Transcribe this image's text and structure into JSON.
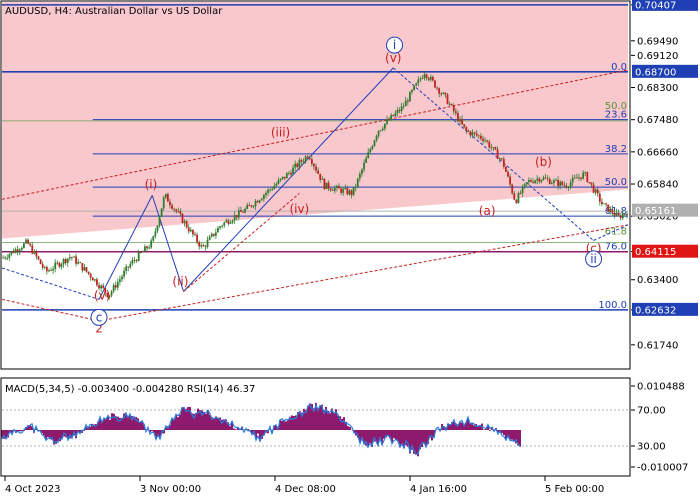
{
  "chart_data": {
    "type": "candlestick",
    "title": "AUDUSD, H4:  Australian Dollar vs US Dollar",
    "price_axis": {
      "ylim": [
        0.6115,
        0.7048
      ],
      "ticks": [
        "0.70407",
        "0.69490",
        "0.69120",
        "0.68300",
        "0.67480",
        "0.66660",
        "0.65840",
        "0.65020",
        "0.64115",
        "0.63400",
        "0.62632",
        "0.61740"
      ]
    },
    "price_tags": [
      {
        "label": "0.70407",
        "value": 0.70407,
        "color": "#1f3fb5"
      },
      {
        "label": "0.68700",
        "value": 0.687,
        "color": "#1f3fb5"
      },
      {
        "label": "0.65161",
        "value": 0.65161,
        "color": "#b0b0b0"
      },
      {
        "label": "0.64115",
        "value": 0.64115,
        "color": "#e01414"
      },
      {
        "label": "0.62632",
        "value": 0.62632,
        "color": "#1f3fb5"
      }
    ],
    "fib_levels": [
      {
        "label": "0.0",
        "value": 0.687
      },
      {
        "label": "23.6",
        "value": 0.6748
      },
      {
        "label": "38.2",
        "value": 0.6661
      },
      {
        "label": "50.0",
        "value": 0.6576
      },
      {
        "label": "61.8",
        "value": 0.6502
      },
      {
        "label": "76.0",
        "value": 0.64115
      },
      {
        "label": "100.0",
        "value": 0.62632
      }
    ],
    "extra_fib_labels": [
      {
        "label": "50.0",
        "value": 0.677
      },
      {
        "label": "61.8",
        "value": 0.645
      }
    ],
    "x_axis": {
      "labels": [
        "4 Oct 2023",
        "3 Nov 00:00",
        "4 Dec 08:00",
        "4 Jan 16:00",
        "5 Feb 00:00"
      ],
      "positions": [
        0,
        0.25,
        0.5,
        0.75,
        1.0
      ]
    },
    "price_path": {
      "t": [
        0,
        0.04,
        0.07,
        0.11,
        0.145,
        0.17,
        0.205,
        0.24,
        0.26,
        0.285,
        0.32,
        0.35,
        0.39,
        0.42,
        0.45,
        0.49,
        0.515,
        0.56,
        0.6,
        0.64,
        0.675,
        0.71,
        0.74,
        0.77,
        0.8,
        0.82,
        0.84,
        0.86,
        0.88,
        0.9,
        0.93,
        0.96,
        0.985,
        1.0
      ],
      "v": [
        0.6395,
        0.6435,
        0.636,
        0.64,
        0.6345,
        0.63,
        0.638,
        0.6435,
        0.6555,
        0.65,
        0.642,
        0.648,
        0.652,
        0.656,
        0.66,
        0.666,
        0.658,
        0.656,
        0.672,
        0.678,
        0.687,
        0.68,
        0.672,
        0.67,
        0.664,
        0.654,
        0.659,
        0.66,
        0.659,
        0.658,
        0.661,
        0.653,
        0.65,
        0.6515
      ]
    },
    "wave_labels": [
      {
        "text": "(v)",
        "t": 0.16,
        "v": 0.629,
        "style": "red"
      },
      {
        "text": "2",
        "t": 0.155,
        "v": 0.6206,
        "style": "red"
      },
      {
        "text": "c",
        "t": 0.155,
        "v": 0.6234,
        "style": "blue-circle"
      },
      {
        "text": "(i)",
        "t": 0.238,
        "v": 0.6572,
        "style": "red"
      },
      {
        "text": "(ii)",
        "t": 0.285,
        "v": 0.6325,
        "style": "red"
      },
      {
        "text": "(iii)",
        "t": 0.445,
        "v": 0.6705,
        "style": "red"
      },
      {
        "text": "(iv)",
        "t": 0.475,
        "v": 0.651,
        "style": "red"
      },
      {
        "text": "(v)",
        "t": 0.625,
        "v": 0.6895,
        "style": "red"
      },
      {
        "text": "i",
        "t": 0.627,
        "v": 0.6928,
        "style": "blue-circle"
      },
      {
        "text": "(a)",
        "t": 0.775,
        "v": 0.6505,
        "style": "red"
      },
      {
        "text": "(b)",
        "t": 0.865,
        "v": 0.663,
        "style": "red"
      },
      {
        "text": "(c)",
        "t": 0.945,
        "v": 0.641,
        "style": "red"
      },
      {
        "text": "ii",
        "t": 0.945,
        "v": 0.6383,
        "style": "blue-circle"
      }
    ],
    "oscillator": {
      "label": "MACD(5,34,5) -0.003400 -0.004280 RSI(14) 46.37",
      "ticks": [
        "0.010488",
        "70.00",
        "30.00",
        "-0.010007"
      ],
      "macd_path": {
        "t": [
          0,
          0.05,
          0.1,
          0.15,
          0.2,
          0.25,
          0.3,
          0.35,
          0.4,
          0.45,
          0.5,
          0.55,
          0.6,
          0.65,
          0.7,
          0.75,
          0.8,
          0.85,
          0.9,
          0.95,
          1.0
        ],
        "v": [
          -0.002,
          0.001,
          -0.003,
          -0.001,
          0.003,
          0.004,
          -0.002,
          0.005,
          0.004,
          0.001,
          -0.002,
          0.003,
          0.006,
          0.004,
          -0.004,
          -0.002,
          -0.006,
          0.001,
          0.002,
          0.0,
          -0.0035
        ]
      }
    }
  }
}
